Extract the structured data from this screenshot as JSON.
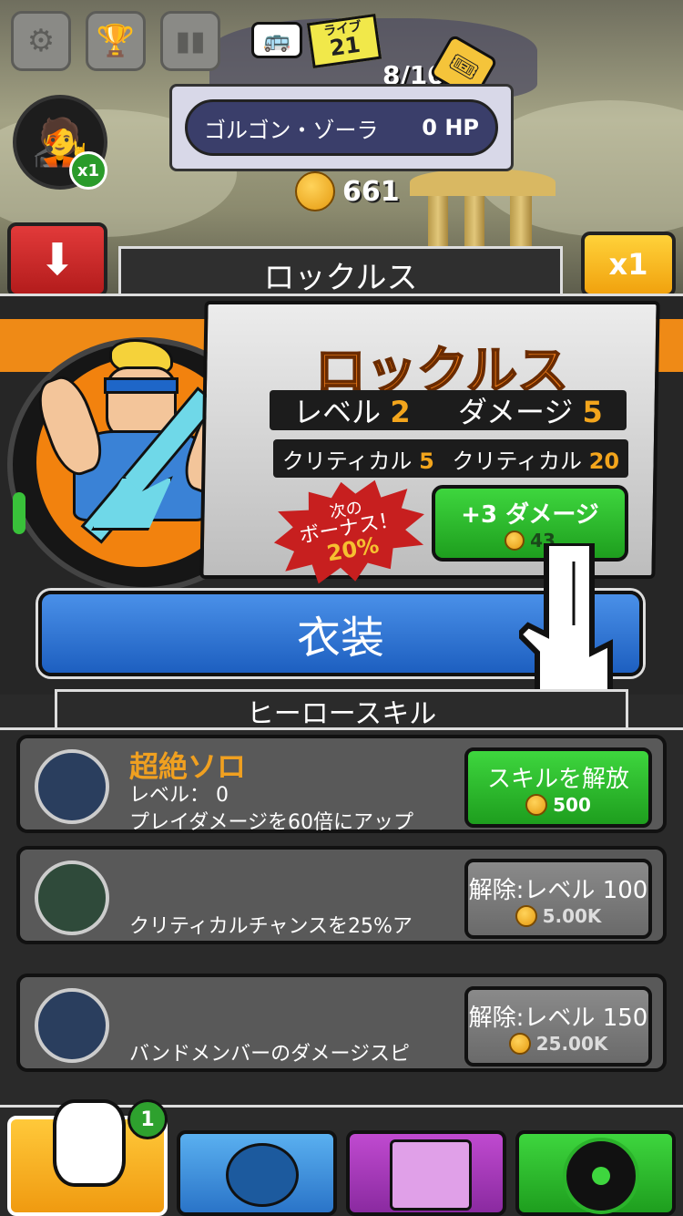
{
  "top": {
    "live_label": "ライブ",
    "live_number": "21",
    "progress": "8/10",
    "boss_name": "ゴルゴン・ゾーラ",
    "boss_hp": "0 HP",
    "coins": "661",
    "avatar_multiplier": "x1",
    "multiplier_button": "x1"
  },
  "hero": {
    "header": "ロックルス",
    "name": "ロックルス",
    "level_label": "レベル",
    "level_value": "2",
    "damage_label": "ダメージ",
    "damage_value": "5",
    "crit_label_1": "クリティカル",
    "crit_value_1": "5",
    "crit_label_2": "クリティカル",
    "crit_value_2": "20",
    "bonus_line1": "次の",
    "bonus_line2": "ボーナス！",
    "bonus_value": "20%",
    "upgrade_label": "+3 ダメージ",
    "upgrade_cost": "43",
    "costume_button": "衣装"
  },
  "skills": {
    "header": "ヒーロースキル",
    "items": [
      {
        "title": "超絶ソロ",
        "level": "レベル： 0",
        "desc": "プレイダメージを60倍にアップ",
        "button": "スキルを解放",
        "cost": "500"
      },
      {
        "desc": "クリティカルチャンスを25%ア",
        "button": "解除:レベル 100",
        "cost": "5.00K"
      },
      {
        "desc": "バンドメンバーのダメージスピ",
        "button": "解除:レベル 150",
        "cost": "25.00K"
      }
    ]
  },
  "nav": {
    "badge": "1"
  },
  "colors": {
    "orange": "#ef8a16",
    "green": "#2ea12e",
    "blue": "#1d5fc0",
    "red": "#c71f1f",
    "yellow": "#f1a20e"
  }
}
